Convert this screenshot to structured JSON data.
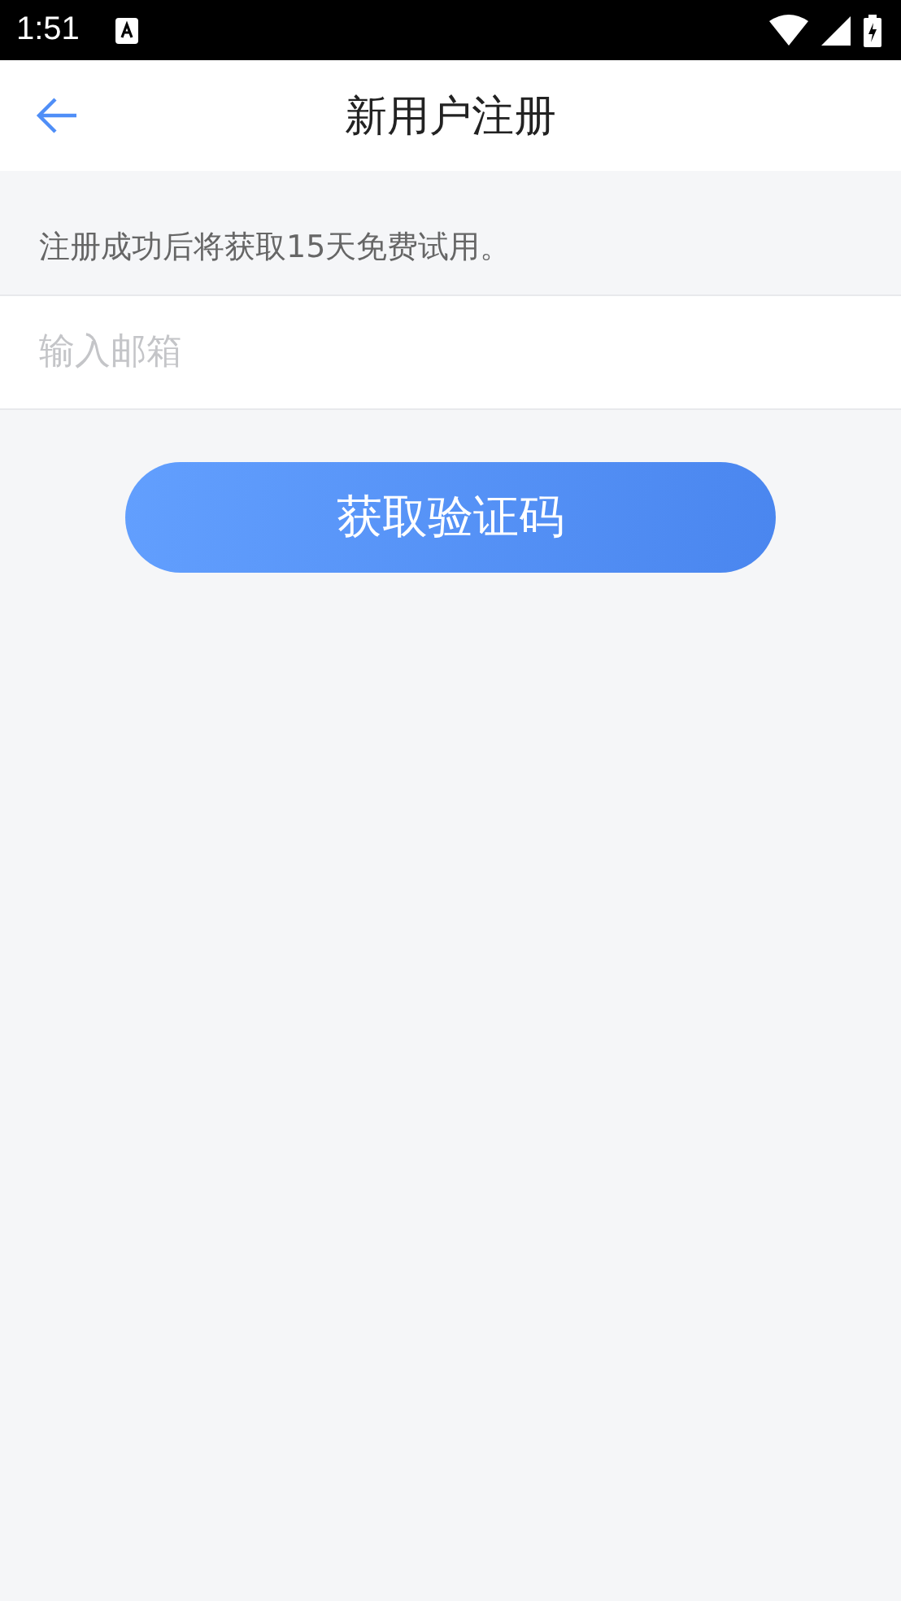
{
  "status_bar": {
    "time": "1:51"
  },
  "header": {
    "title": "新用户注册"
  },
  "notice": "注册成功后将获取15天免费试用。",
  "email_field": {
    "placeholder": "输入邮箱"
  },
  "submit_button": {
    "label": "获取验证码"
  }
}
